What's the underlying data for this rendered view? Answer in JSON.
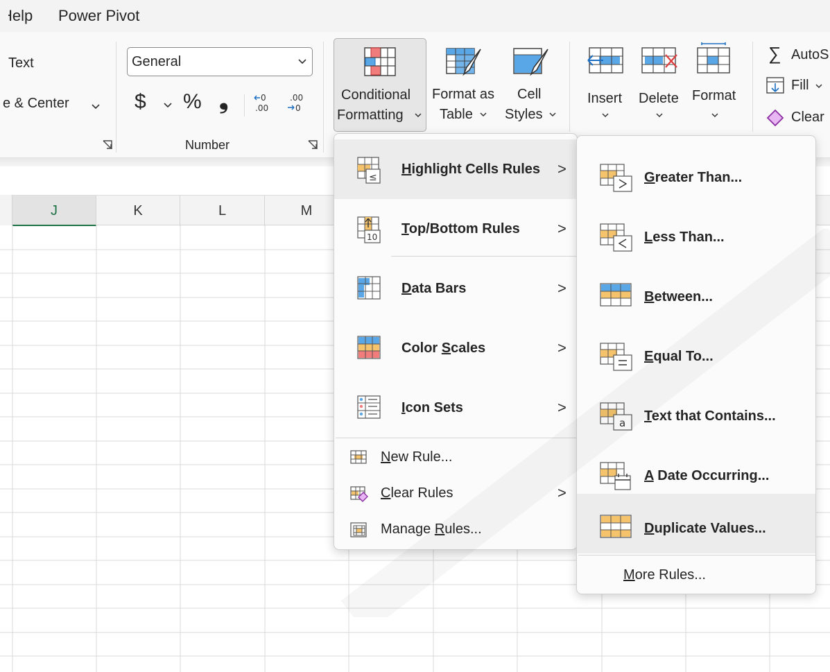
{
  "menu_tabs": [
    "Help",
    "Power Pivot"
  ],
  "ribbon": {
    "wrap_text": "Text",
    "merge_center": "e & Center",
    "number_format": "General",
    "currency_symbol": "$",
    "percent_symbol": "%",
    "comma_symbol": "❟",
    "number_group_label": "Number",
    "conditional_formatting": [
      "Conditional",
      "Formatting"
    ],
    "format_as_table": [
      "Format as",
      "Table"
    ],
    "cell_styles": [
      "Cell",
      "Styles"
    ],
    "insert": "Insert",
    "delete": "Delete",
    "format": "Format",
    "autosum": "AutoS",
    "fill": "Fill",
    "clear": "Clear"
  },
  "columns": [
    "J",
    "K",
    "L",
    "M"
  ],
  "cf_menu": {
    "items": [
      {
        "label": "Highlight Cells Rules",
        "hotkey_index": 0
      },
      {
        "label": "Top/Bottom Rules",
        "hotkey_index": 0
      },
      {
        "label": "Data Bars",
        "hotkey_index": 0
      },
      {
        "label": "Color Scales",
        "hotkey_index": 6
      },
      {
        "label": "Icon Sets",
        "hotkey_index": 0
      }
    ],
    "small_items": [
      {
        "label": "New Rule..."
      },
      {
        "label": "Clear Rules"
      },
      {
        "label": "Manage Rules..."
      }
    ]
  },
  "sub_menu": {
    "items": [
      {
        "label": "Greater Than..."
      },
      {
        "label": "Less Than..."
      },
      {
        "label": "Between..."
      },
      {
        "label": "Equal To..."
      },
      {
        "label": "Text that Contains..."
      },
      {
        "label": "A Date Occurring..."
      },
      {
        "label": "Duplicate Values..."
      }
    ],
    "more_rules": "More Rules..."
  },
  "colors": {
    "accent_orange": "#f4c36b",
    "accent_blue": "#5aa7e8",
    "accent_red": "#f07c7c",
    "selected_col": "#1e7145"
  }
}
